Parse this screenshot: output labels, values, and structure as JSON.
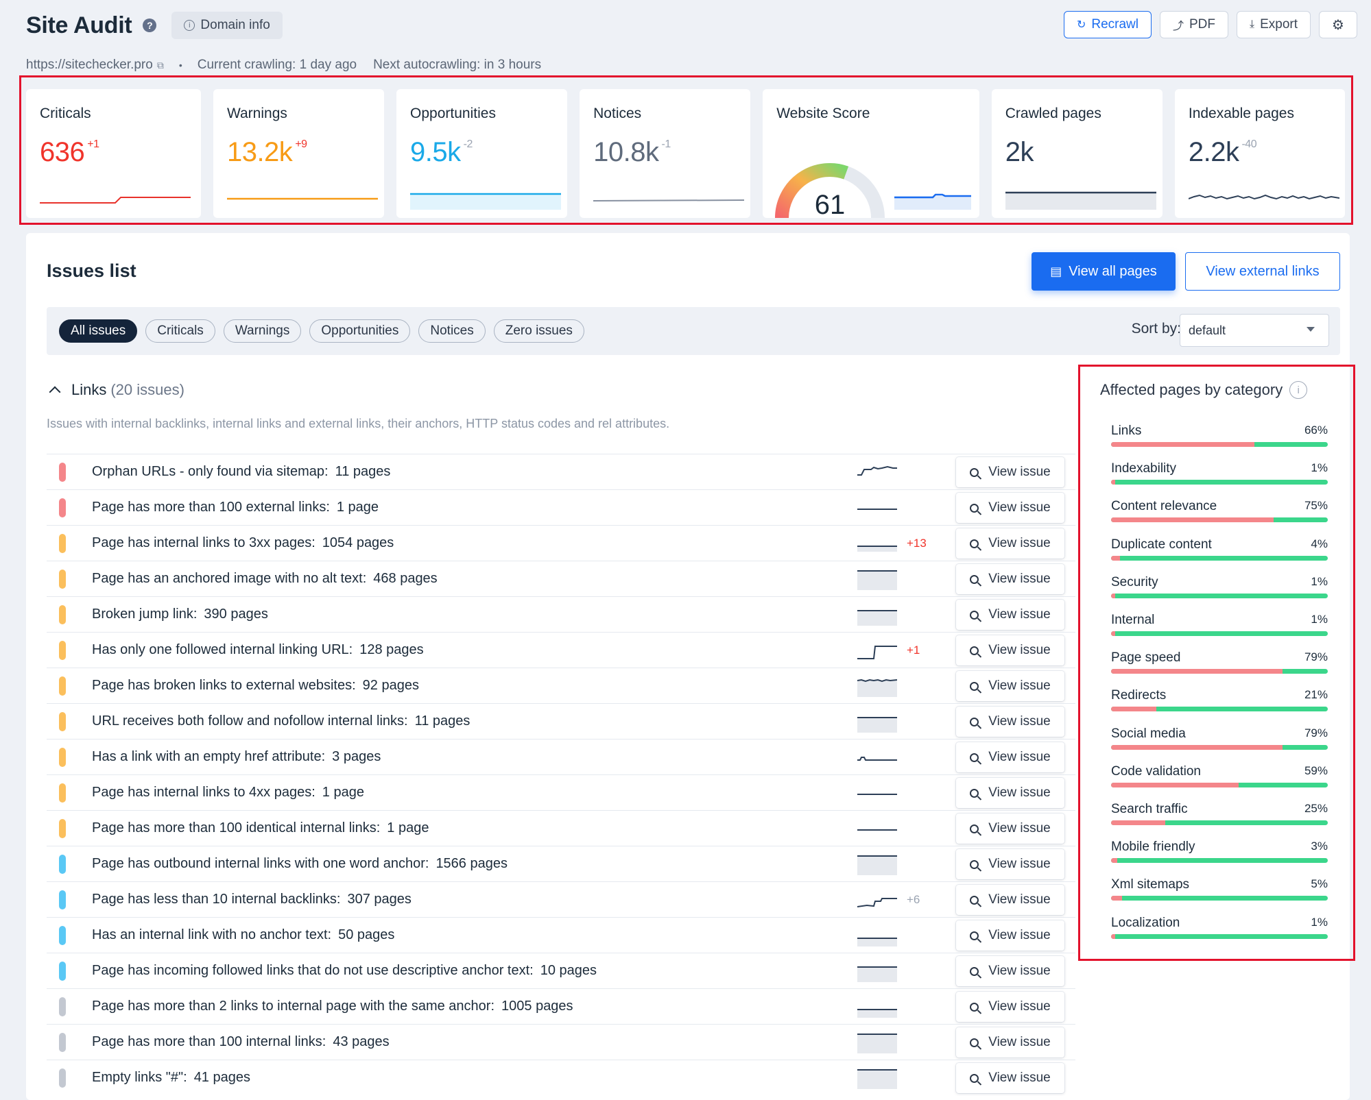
{
  "header": {
    "title": "Site Audit",
    "help_icon": "?",
    "domain_info_label": "Domain info",
    "actions": {
      "recrawl": "Recrawl",
      "pdf": "PDF",
      "export": "Export",
      "settings_icon": "gear-icon"
    },
    "url": "https://sitechecker.pro",
    "current_crawling": "Current crawling: 1 day ago",
    "next_autocrawling": "Next autocrawling: in 3 hours"
  },
  "stats": [
    {
      "label": "Criticals",
      "value": "636",
      "delta": "+1",
      "color": "#f0342b"
    },
    {
      "label": "Warnings",
      "value": "13.2k",
      "delta": "+9",
      "color": "#f79b16"
    },
    {
      "label": "Opportunities",
      "value": "9.5k",
      "delta": "-2",
      "color": "#1aa9e8"
    },
    {
      "label": "Notices",
      "value": "10.8k",
      "delta": "-1",
      "color": "#5f6b7c"
    },
    {
      "label": "Website Score",
      "value": "61",
      "score": 61
    },
    {
      "label": "Crawled pages",
      "value": "2k",
      "delta": ""
    },
    {
      "label": "Indexable pages",
      "value": "2.2k",
      "delta": "-40"
    }
  ],
  "issues_list": {
    "title": "Issues list",
    "view_all_pages": "View all pages",
    "view_external_links": "View external links",
    "filters": [
      "All issues",
      "Criticals",
      "Warnings",
      "Opportunities",
      "Notices",
      "Zero issues"
    ],
    "active_filter": "All issues",
    "sort_label": "Sort by:",
    "sort_value": "default",
    "group": {
      "name": "Links",
      "count": "(20 issues)",
      "description": "Issues with internal backlinks, internal links and external links, their anchors, HTTP status codes and rel attributes.",
      "view_label": "View issue",
      "rows": [
        {
          "title": "Orphan URLs - only found via sitemap:",
          "pages": "11 pages",
          "severity": "critical",
          "change": "",
          "spark": "orphan"
        },
        {
          "title": "Page has more than 100 external links:",
          "pages": "1 page",
          "severity": "critical",
          "change": "",
          "spark": "flat"
        },
        {
          "title": "Page has internal links to 3xx pages:",
          "pages": "1054 pages",
          "severity": "warning",
          "change": "+13",
          "spark": "flat-low"
        },
        {
          "title": "Page has an anchored image with no alt text:",
          "pages": "468 pages",
          "severity": "warning",
          "change": "",
          "spark": "area-top"
        },
        {
          "title": "Broken jump link:",
          "pages": "390 pages",
          "severity": "warning",
          "change": "",
          "spark": "area-mid"
        },
        {
          "title": "Has only one followed internal linking URL:",
          "pages": "128 pages",
          "severity": "warning",
          "change": "+1",
          "spark": "step"
        },
        {
          "title": "Page has broken links to external websites:",
          "pages": "92 pages",
          "severity": "warning",
          "change": "",
          "spark": "area-wave"
        },
        {
          "title": "URL receives both follow and nofollow internal links:",
          "pages": "11 pages",
          "severity": "warning",
          "change": "",
          "spark": "area-mid"
        },
        {
          "title": "Has a link with an empty href attribute:",
          "pages": "3 pages",
          "severity": "warning",
          "change": "",
          "spark": "bump"
        },
        {
          "title": "Page has internal links to 4xx pages:",
          "pages": "1 page",
          "severity": "warning",
          "change": "",
          "spark": "flat"
        },
        {
          "title": "Page has more than 100 identical internal links:",
          "pages": "1 page",
          "severity": "warning",
          "change": "",
          "spark": "flat"
        },
        {
          "title": "Page has outbound internal links with one word anchor:",
          "pages": "1566 pages",
          "severity": "opportunity",
          "change": "",
          "spark": "area-top"
        },
        {
          "title": "Page has less than 10 internal backlinks:",
          "pages": "307 pages",
          "severity": "opportunity",
          "change": "+6",
          "spark": "step-small"
        },
        {
          "title": "Has an internal link with no anchor text:",
          "pages": "50 pages",
          "severity": "opportunity",
          "change": "",
          "spark": "area-low"
        },
        {
          "title": "Page has incoming followed links that do not use descriptive anchor text:",
          "pages": "10 pages",
          "severity": "opportunity",
          "change": "",
          "spark": "area-mid"
        },
        {
          "title": "Page has more than 2 links to internal page with the same anchor:",
          "pages": "1005 pages",
          "severity": "notice",
          "change": "",
          "spark": "area-low"
        },
        {
          "title": "Page has more than 100 internal links:",
          "pages": "43 pages",
          "severity": "notice",
          "change": "",
          "spark": "area-top"
        },
        {
          "title": "Empty links \"#\":",
          "pages": "41 pages",
          "severity": "notice",
          "change": "",
          "spark": "area-top"
        }
      ]
    }
  },
  "affected": {
    "title": "Affected pages by category",
    "info_icon": "i",
    "categories": [
      {
        "name": "Links",
        "percent": "66%",
        "value": 66
      },
      {
        "name": "Indexability",
        "percent": "1%",
        "value": 1
      },
      {
        "name": "Content relevance",
        "percent": "75%",
        "value": 75
      },
      {
        "name": "Duplicate content",
        "percent": "4%",
        "value": 4
      },
      {
        "name": "Security",
        "percent": "1%",
        "value": 1
      },
      {
        "name": "Internal",
        "percent": "1%",
        "value": 1
      },
      {
        "name": "Page speed",
        "percent": "79%",
        "value": 79
      },
      {
        "name": "Redirects",
        "percent": "21%",
        "value": 21
      },
      {
        "name": "Social media",
        "percent": "79%",
        "value": 79
      },
      {
        "name": "Code validation",
        "percent": "59%",
        "value": 59
      },
      {
        "name": "Search traffic",
        "percent": "25%",
        "value": 25
      },
      {
        "name": "Mobile friendly",
        "percent": "3%",
        "value": 3
      },
      {
        "name": "Xml sitemaps",
        "percent": "5%",
        "value": 5
      },
      {
        "name": "Localization",
        "percent": "1%",
        "value": 1
      }
    ]
  },
  "colors": {
    "critical": "#f4868a",
    "warning": "#fbbf5c",
    "opportunity": "#5ac8f5",
    "notice": "#c3c8d1",
    "accent": "#1a6cf0",
    "change_red": "#f0342b",
    "change_grey": "#9aa3b1"
  }
}
